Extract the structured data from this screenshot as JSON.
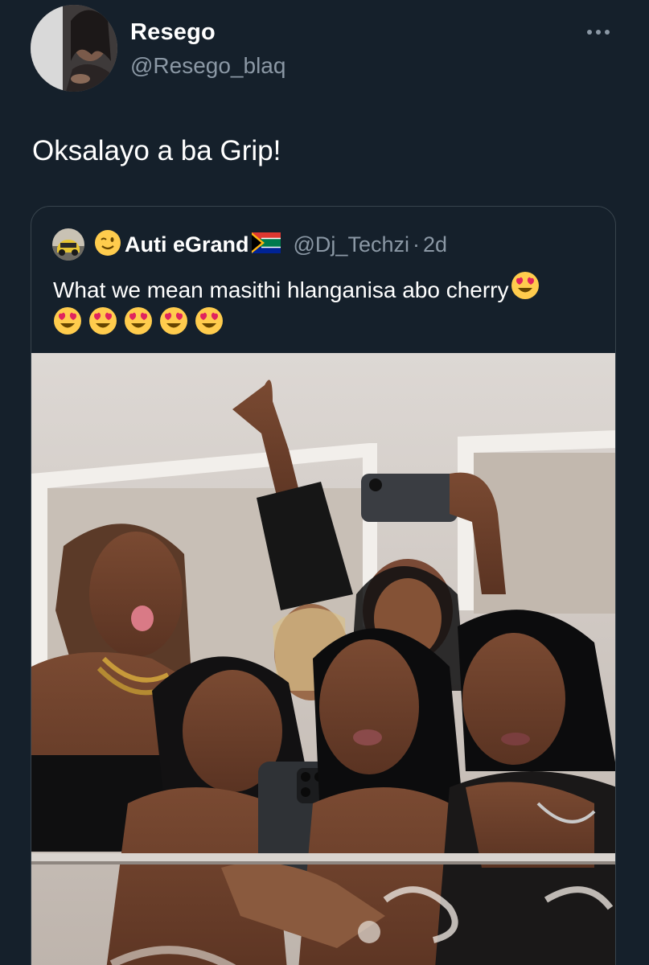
{
  "tweet": {
    "author": {
      "name": "Resego",
      "handle": "@Resego_blaq"
    },
    "more_icon": "ellipsis-icon",
    "text": "Oksalayo a ba Grip!",
    "quoted": {
      "name": "Auti eGrand",
      "name_prefix_emoji": "winking-face-emoji",
      "name_suffix_emoji": "south-africa-flag-emoji",
      "handle": "@Dj_Techzi",
      "separator": "·",
      "time": "2d",
      "text": "What we mean masithi hlanganisa abo cherry",
      "emoji": "heart-eyes-emoji",
      "trailing_emoji_count": 6,
      "media": "group-mirror-selfie-photo"
    }
  },
  "colors": {
    "background": "#15202b",
    "primary_text": "#ffffff",
    "secondary_text": "#8b98a5",
    "border": "#38444d"
  }
}
